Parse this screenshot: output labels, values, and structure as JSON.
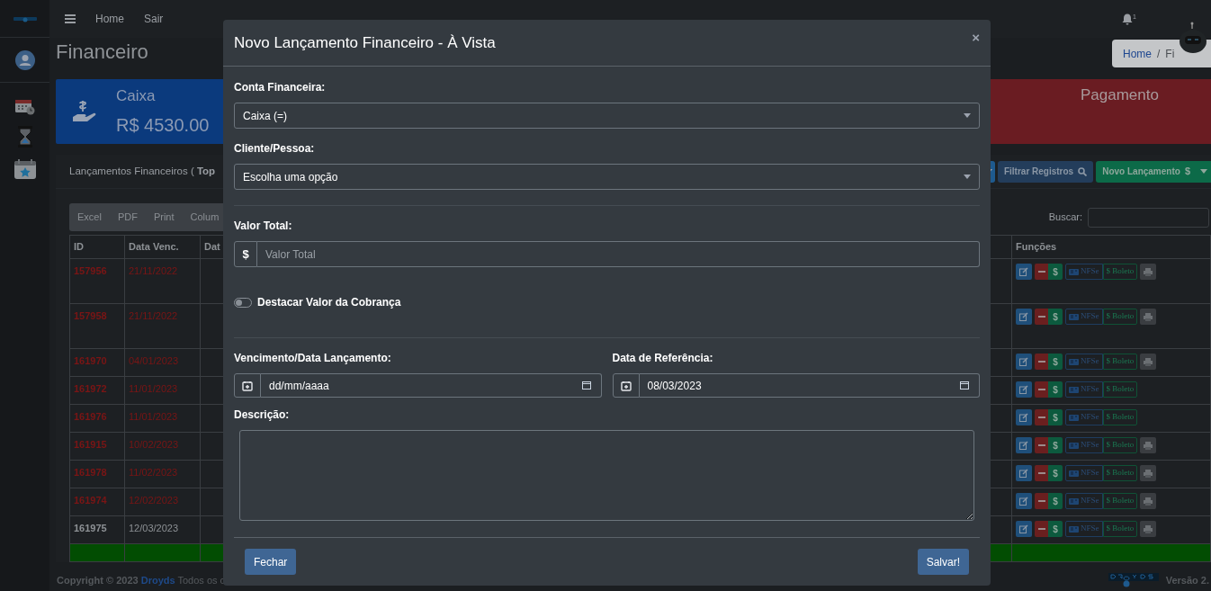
{
  "topbar": {
    "links": [
      "Home",
      "Sair"
    ],
    "notification_count": "1"
  },
  "page": {
    "title": "Financeiro",
    "breadcrumb": [
      "Home",
      "/",
      "Fi"
    ]
  },
  "cards": [
    {
      "kind": "balance",
      "title": "Caixa",
      "value": "R$ 4530.00"
    },
    {
      "kind": "alert",
      "title": "Pagamento"
    }
  ],
  "panel": {
    "title": "Lançamentos Financeiros (",
    "title_bold": "Top",
    "actions": [
      {
        "kind": "caret"
      },
      {
        "kind": "filter",
        "label": "Filtrar Registros"
      },
      {
        "kind": "new",
        "label": "Novo Lançamento",
        "icon": "$"
      }
    ],
    "export_buttons": [
      "Excel",
      "PDF",
      "Print",
      "Colum"
    ],
    "search_label": "Buscar:",
    "columns": [
      "ID",
      "Data Venc.",
      "Dat",
      "Funções"
    ],
    "rows": [
      {
        "id": "157956",
        "due": "21/11/2022",
        "overdue": true,
        "print": true,
        "pay": "$",
        "nfse": "NFSe",
        "boleto": "$ Boleto"
      },
      {
        "id": "157958",
        "due": "21/11/2022",
        "overdue": true,
        "print": true,
        "pay": "$",
        "nfse": "NFSe",
        "boleto": "$ Boleto"
      },
      {
        "id": "161970",
        "due": "04/01/2023",
        "overdue": true,
        "print": true,
        "pay": "$",
        "nfse": "NFSe",
        "boleto": "$ Boleto"
      },
      {
        "id": "161972",
        "due": "11/01/2023",
        "overdue": true,
        "print": false,
        "pay": "$",
        "nfse": "NFSe",
        "boleto": "$ Boleto"
      },
      {
        "id": "161976",
        "due": "11/01/2023",
        "overdue": true,
        "print": false,
        "pay": "$",
        "nfse": "NFSe",
        "boleto": "$ Boleto"
      },
      {
        "id": "161915",
        "due": "10/02/2023",
        "overdue": true,
        "print": true,
        "pay": "$",
        "nfse": "NFSe",
        "boleto": "$ Boleto"
      },
      {
        "id": "161978",
        "due": "11/02/2023",
        "overdue": true,
        "print": true,
        "pay": "$",
        "nfse": "NFSe",
        "boleto": "$ Boleto"
      },
      {
        "id": "161974",
        "due": "12/02/2023",
        "overdue": true,
        "print": true,
        "pay": "$",
        "nfse": "NFSe",
        "boleto": "$ Boleto"
      },
      {
        "id": "161975",
        "due": "12/03/2023",
        "overdue": false,
        "print": true,
        "pay": "$",
        "nfse": "NFSe",
        "boleto": "$ Boleto"
      }
    ]
  },
  "footer": {
    "copyright": "Copyright © 2023",
    "brand": "Droyds",
    "rest": "Todos os c",
    "version": "Versão 2."
  },
  "modal": {
    "title": "Novo Lançamento Financeiro - À Vista",
    "close": "×",
    "account": {
      "label": "Conta Financeira:",
      "value": "Caixa (=)"
    },
    "client": {
      "label": "Cliente/Pessoa:",
      "value": "Escolha uma opção"
    },
    "total": {
      "label": "Valor Total:",
      "prefix": "$",
      "placeholder": "Valor Total"
    },
    "highlight": {
      "label": "Destacar Valor da Cobrança",
      "on": false
    },
    "due": {
      "label": "Vencimento/Data Lançamento:",
      "placeholder": "dd/mm/aaaa"
    },
    "reference": {
      "label": "Data de Referência:",
      "value": "08/03/2023"
    },
    "description": {
      "label": "Descrição:"
    },
    "buttons": [
      "Fechar",
      "Salvar!"
    ]
  }
}
